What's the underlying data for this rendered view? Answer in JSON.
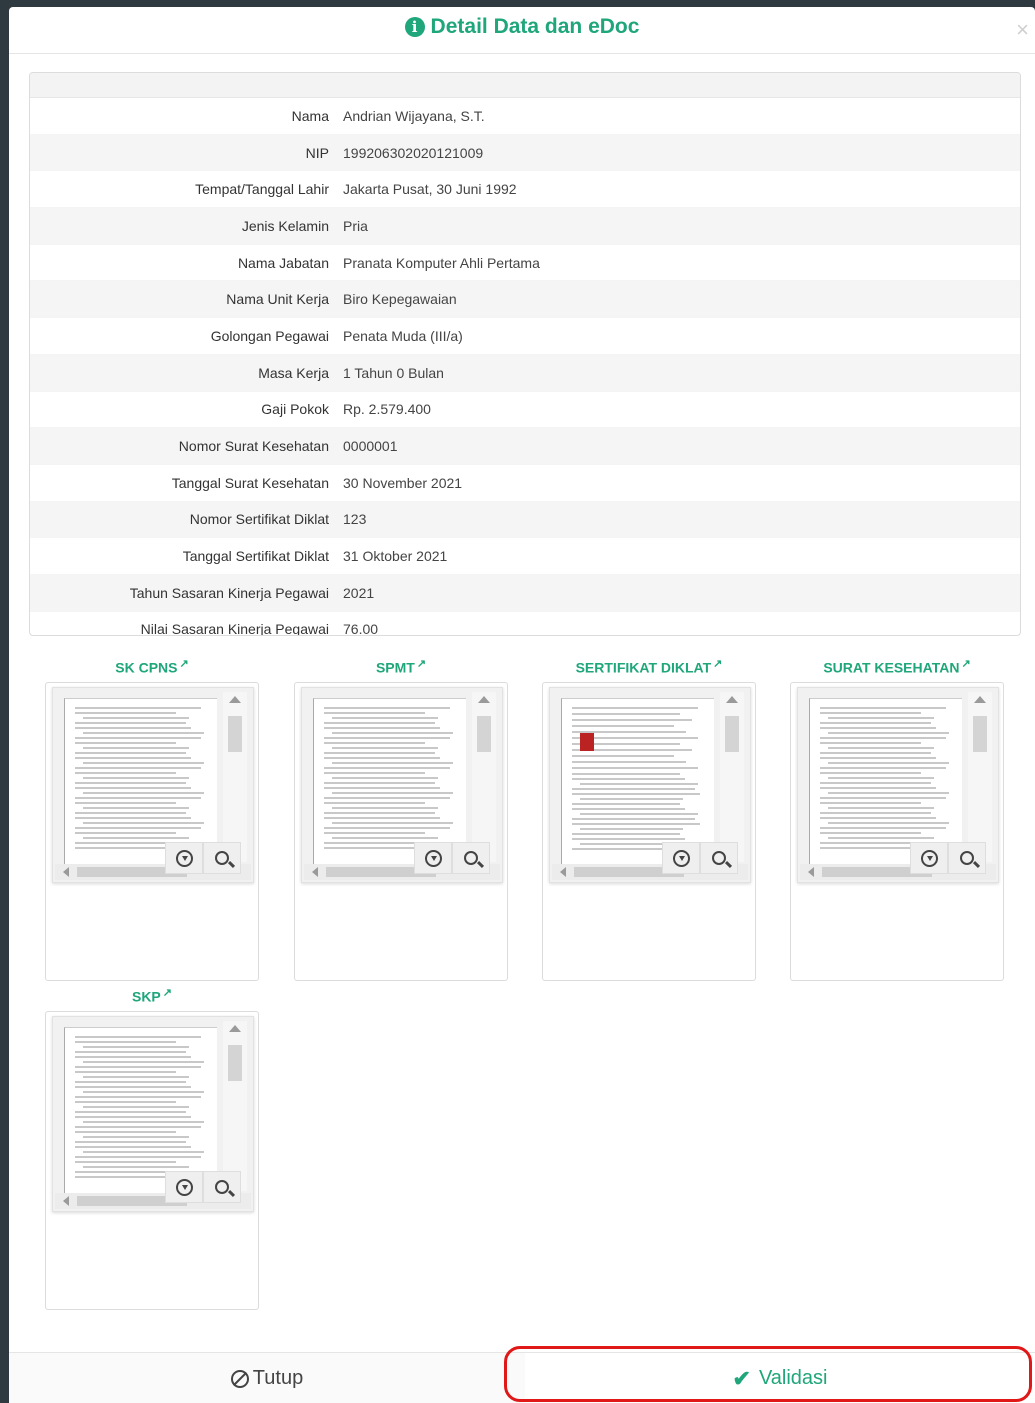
{
  "modal": {
    "title": "Detail Data dan eDoc",
    "close": "×"
  },
  "details": [
    {
      "label": "Nama",
      "value": "Andrian Wijayana, S.T."
    },
    {
      "label": "NIP",
      "value": "199206302020121009"
    },
    {
      "label": "Tempat/Tanggal Lahir",
      "value": "Jakarta Pusat, 30 Juni 1992"
    },
    {
      "label": "Jenis Kelamin",
      "value": "Pria"
    },
    {
      "label": "Nama Jabatan",
      "value": "Pranata Komputer Ahli Pertama"
    },
    {
      "label": "Nama Unit Kerja",
      "value": "Biro Kepegawaian"
    },
    {
      "label": "Golongan Pegawai",
      "value": "Penata Muda (III/a)"
    },
    {
      "label": "Masa Kerja",
      "value": "1 Tahun 0 Bulan"
    },
    {
      "label": "Gaji Pokok",
      "value": "Rp. 2.579.400"
    },
    {
      "label": "Nomor Surat Kesehatan",
      "value": "0000001"
    },
    {
      "label": "Tanggal Surat Kesehatan",
      "value": "30 November 2021"
    },
    {
      "label": "Nomor Sertifikat Diklat",
      "value": "123"
    },
    {
      "label": "Tanggal Sertifikat Diklat",
      "value": "31 Oktober 2021"
    },
    {
      "label": "Tahun Sasaran Kinerja Pegawai",
      "value": "2021"
    },
    {
      "label": "Nilai Sasaran Kinerja Pegawai",
      "value": "76.00"
    }
  ],
  "documents": [
    {
      "title": "SK CPNS"
    },
    {
      "title": "SPMT"
    },
    {
      "title": "SERTIFIKAT DIKLAT"
    },
    {
      "title": "SURAT KESEHATAN"
    },
    {
      "title": "SKP"
    }
  ],
  "footer": {
    "close_label": "Tutup",
    "validate_label": "Validasi"
  },
  "colors": {
    "accent": "#1fa67a",
    "highlight": "#e01818"
  }
}
